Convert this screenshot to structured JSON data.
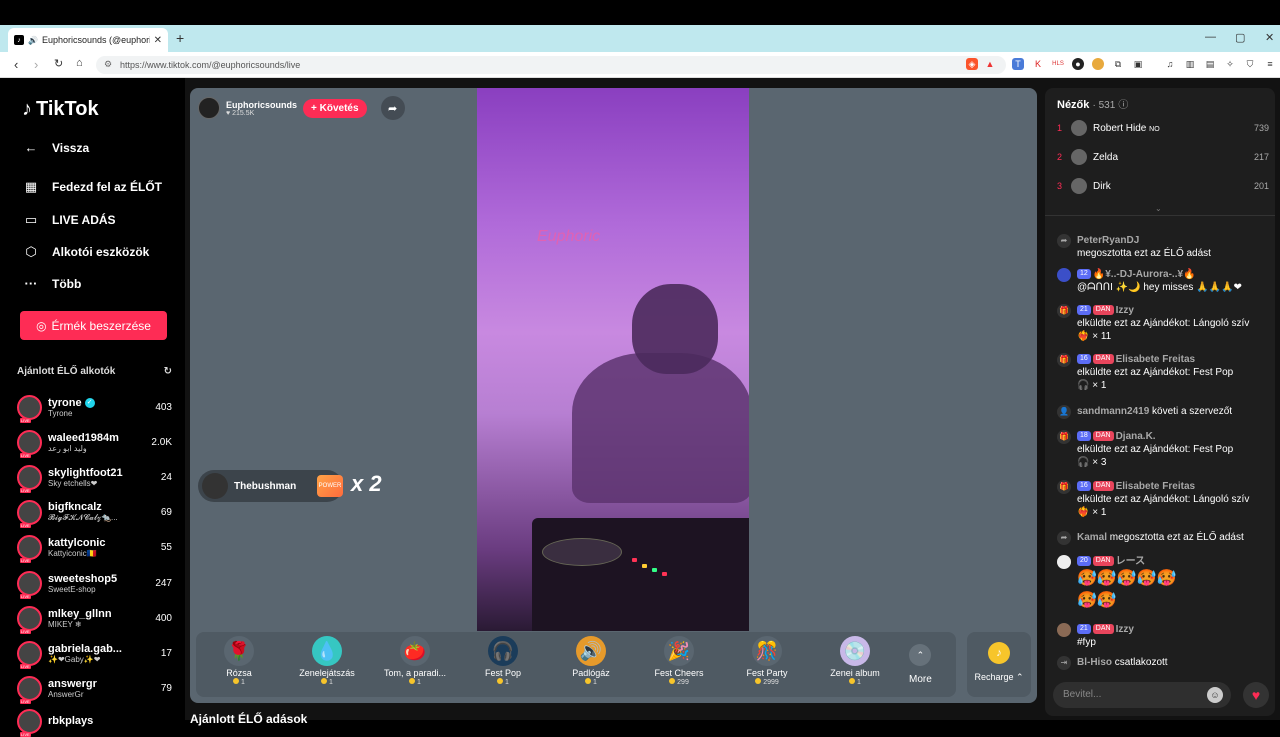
{
  "browser": {
    "tab_title": "Euphoricsounds (@euphoricsounds)",
    "url": "https://www.tiktok.com/@euphoricsounds/live",
    "new_tab": "+",
    "tab_close": "✕"
  },
  "sidebar": {
    "logo": "TikTok",
    "back": "Vissza",
    "nav": [
      {
        "label": "Fedezd fel az ÉLŐT",
        "icon": "calendar-live-icon"
      },
      {
        "label": "LIVE ADÁS",
        "icon": "camera-icon"
      },
      {
        "label": "Alkotói eszközök",
        "icon": "creator-tools-icon"
      },
      {
        "label": "Több",
        "icon": "more-dots-icon"
      }
    ],
    "coins_button": "Érmék beszerzése",
    "recommended_title": "Ajánlott ÉLŐ alkotók",
    "creators": [
      {
        "name": "tyrone",
        "sub": "Tyrone",
        "count": "403",
        "verified": true
      },
      {
        "name": "waleed1984m",
        "sub": "وليد ابو رعد",
        "count": "2.0K"
      },
      {
        "name": "skylightfoot21",
        "sub": "Sky etchells❤",
        "count": "24"
      },
      {
        "name": "bigfkncalz",
        "sub": "𝓑𝓲𝓰𝓕𝓚𝓝𝓒𝓪𝓵𝔃🐀...",
        "count": "69"
      },
      {
        "name": "kattylconic",
        "sub": "Kattyiconic🇷🇴",
        "count": "55"
      },
      {
        "name": "sweeteshop5",
        "sub": "SweetE-shop",
        "count": "247"
      },
      {
        "name": "mlkey_gllnn",
        "sub": "MIKEY ❄",
        "count": "400"
      },
      {
        "name": "gabriela.gab...",
        "sub": "✨❤Gaby✨❤",
        "count": "17"
      },
      {
        "name": "answergr",
        "sub": "AnswerGr",
        "count": "79"
      },
      {
        "name": "rbkplays",
        "sub": "",
        "count": ""
      }
    ],
    "bottom_section": "Ajánlott ÉLŐ adások"
  },
  "stream": {
    "host_name": "Euphoricsounds",
    "host_likes": "215.5K",
    "follow_label": "+ Követés",
    "neon_sign": "Euphoric",
    "gift_popup": {
      "user": "Thebushman",
      "gift": "POWER",
      "combo": "x 2"
    }
  },
  "gifts": [
    {
      "name": "Rózsa",
      "price": "1",
      "icon": "🌹",
      "bg": "#5a6670"
    },
    {
      "name": "Zenelejátszás",
      "price": "1",
      "icon": "💧",
      "bg": "#36c7c2"
    },
    {
      "name": "Tom, a paradi...",
      "price": "1",
      "icon": "🍅",
      "bg": "#5a6670"
    },
    {
      "name": "Fest Pop",
      "price": "1",
      "icon": "🎧",
      "bg": "#1b3c5a"
    },
    {
      "name": "Padlógáz",
      "price": "1",
      "icon": "🥭",
      "bg": "#e69a2b"
    },
    {
      "name": "Fest Cheers",
      "price": "299",
      "icon": "🎉",
      "bg": "#5a6670"
    },
    {
      "name": "Fest Party",
      "price": "2999",
      "icon": "🪩",
      "bg": "#5a6670"
    },
    {
      "name": "Zenei album",
      "price": "1",
      "icon": "💿",
      "bg": "#c8b8e8"
    }
  ],
  "more_label": "More",
  "recharge_label": "Recharge",
  "chat": {
    "viewers_title": "Nézők",
    "viewers_count": "· 531",
    "top_viewers": [
      {
        "rank": "1",
        "name": "Robert Hide",
        "tag": "NO",
        "score": "739"
      },
      {
        "rank": "2",
        "name": "Zelda",
        "tag": "",
        "score": "217"
      },
      {
        "rank": "3",
        "name": "Dirk",
        "tag": "",
        "score": "201"
      }
    ],
    "messages": [
      {
        "user": "PeterRyanDJ",
        "text": "megosztotta ezt az ÉLŐ adást"
      },
      {
        "level": "12",
        "user": "🔥¥..-DJ-Aurora-..¥🔥",
        "text": "@ᗩᑎᑎI ✨🌙 hey misses 🙏🙏🙏❤"
      },
      {
        "level": "21",
        "fan": "DAN",
        "user": "Izzy",
        "text": "elküldte ezt az Ajándékot: Lángoló szív",
        "gift": "❤️‍🔥 × 11"
      },
      {
        "level": "16",
        "fan": "DAN",
        "user": "Elisabete Freitas",
        "text": "elküldte ezt az Ajándékot: Fest Pop",
        "gift": "🎧 × 1"
      },
      {
        "user": "sandmann2419",
        "text": "követi a szervezőt"
      },
      {
        "level": "18",
        "fan": "DAN",
        "user": "Djana.K.",
        "text": "elküldte ezt az Ajándékot: Fest Pop",
        "gift": "🎧 × 3"
      },
      {
        "level": "16",
        "fan": "DAN",
        "user": "Elisabete Freitas",
        "text": "elküldte ezt az Ajándékot: Lángoló szív",
        "gift": "❤️‍🔥 × 1"
      },
      {
        "user": "Kamal",
        "text": "megosztotta ezt az ÉLŐ adást"
      },
      {
        "level": "20",
        "fan": "DAN",
        "user": "レース",
        "emojis": "🥵🥵🥵🥵🥵",
        "emojis2": "🥵🥵"
      },
      {
        "level": "21",
        "fan": "DAN",
        "user": "Izzy",
        "text": "#fyp"
      },
      {
        "user": "Bl-Hiso",
        "text": "csatlakozott"
      }
    ],
    "input_placeholder": "Bevitel..."
  }
}
